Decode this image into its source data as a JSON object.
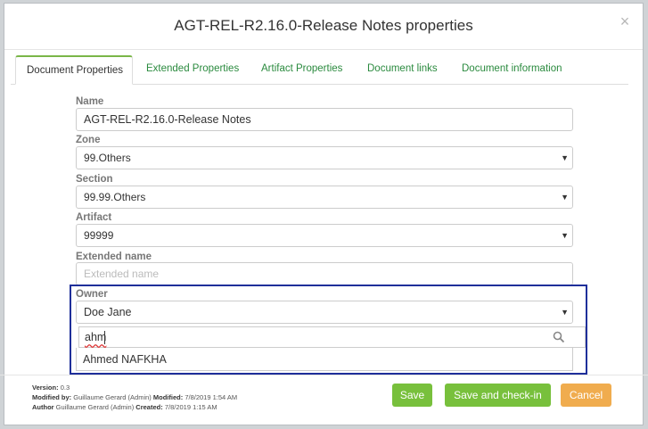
{
  "dialog": {
    "title": "AGT-REL-R2.16.0-Release Notes properties",
    "close_glyph": "×"
  },
  "tabs": [
    {
      "label": "Document Properties",
      "active": true
    },
    {
      "label": "Extended Properties",
      "active": false
    },
    {
      "label": "Artifact Properties",
      "active": false
    },
    {
      "label": "Document links",
      "active": false
    },
    {
      "label": "Document information",
      "active": false
    }
  ],
  "form": {
    "name_label": "Name",
    "name_value": "AGT-REL-R2.16.0-Release Notes",
    "zone_label": "Zone",
    "zone_value": "99.Others",
    "section_label": "Section",
    "section_value": "99.99.Others",
    "artifact_label": "Artifact",
    "artifact_value": "99999",
    "extended_label": "Extended name",
    "extended_placeholder": "Extended name",
    "owner_label": "Owner",
    "owner_value": "Doe Jane",
    "owner_search_value": "ahm",
    "owner_option": "Ahmed NAFKHA"
  },
  "meta": {
    "version_label": "Version:",
    "version_value": "0.3",
    "modified_by_label": "Modified by:",
    "modified_by_value": "Guillaume Gerard (Admin)",
    "modified_label": "Modified:",
    "modified_value": "7/8/2019 1:54 AM",
    "author_label": "Author",
    "author_value": "Guillaume Gerard (Admin)",
    "created_label": "Created:",
    "created_value": "7/8/2019 1:15 AM"
  },
  "buttons": {
    "save": "Save",
    "save_checkin": "Save and check-in",
    "cancel": "Cancel"
  },
  "icons": {
    "dropdown": "caret-down-icon",
    "search": "search-icon",
    "close": "close-icon"
  },
  "colors": {
    "accent_green": "#78c03c",
    "cancel_orange": "#f0ac4e",
    "tab_green": "#2a8a3e",
    "highlight_border": "#1f2f9a"
  }
}
